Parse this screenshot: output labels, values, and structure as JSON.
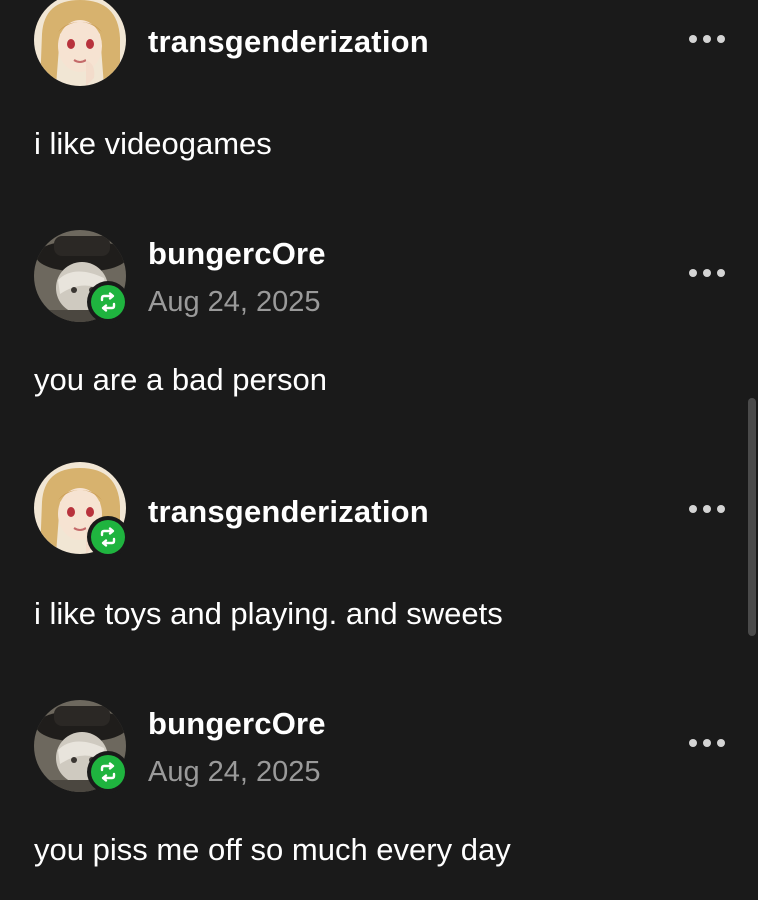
{
  "thread": [
    {
      "username": "transgenderization",
      "date": "",
      "reblogged": false,
      "avatar": "anime-girl-avatar",
      "text": "i like videogames"
    },
    {
      "username": "bungercOre",
      "date": "Aug 24, 2025",
      "reblogged": true,
      "avatar": "hat-character-avatar",
      "text": "you are a bad person"
    },
    {
      "username": "transgenderization",
      "date": "",
      "reblogged": true,
      "avatar": "anime-girl-avatar",
      "text": "i like toys and playing. and sweets"
    },
    {
      "username": "bungercOre",
      "date": "Aug 24, 2025",
      "reblogged": true,
      "avatar": "hat-character-avatar",
      "text": "you piss me off so much every day"
    }
  ],
  "colors": {
    "background": "#1a1a1a",
    "reblog_green": "#1fb43f",
    "date_gray": "#9a9a9a"
  },
  "icons": {
    "more": "more-options-icon",
    "reblog": "reblog-icon"
  }
}
